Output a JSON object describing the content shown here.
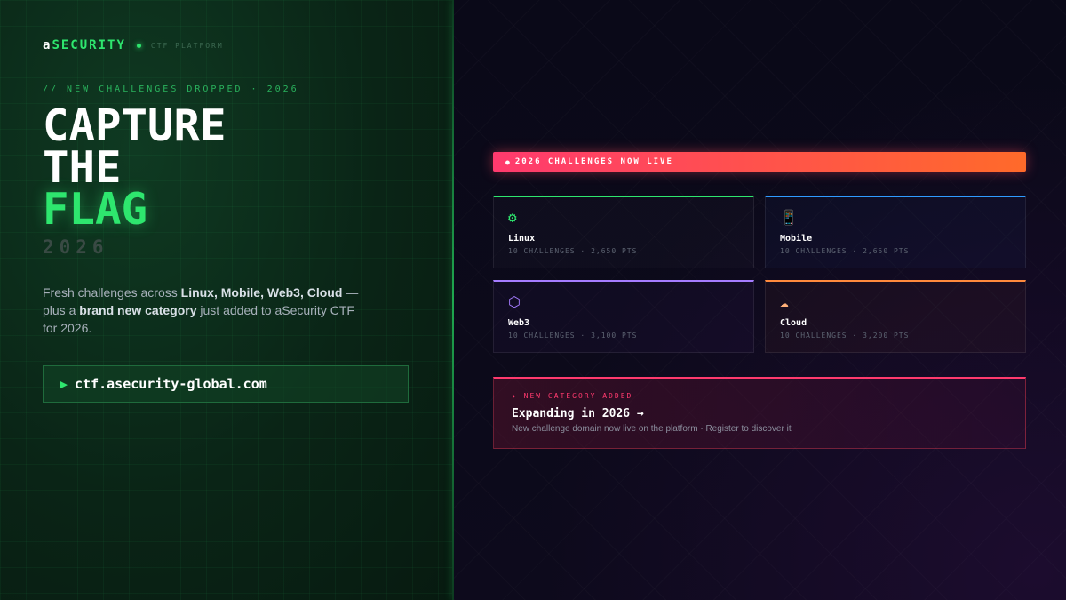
{
  "brand": {
    "prefix": "a",
    "name": "SECURITY",
    "sub": "CTF PLATFORM"
  },
  "hero": {
    "tagline": "// NEW CHALLENGES DROPPED · 2026",
    "line1": "CAPTURE",
    "line2": "THE",
    "line3": "FLAG",
    "year": "2026"
  },
  "description": {
    "t1": "Fresh challenges across ",
    "categories": "Linux, Mobile, Web3, Cloud",
    "t2": " — plus a ",
    "highlight": "brand new category",
    "t3": " just added to aSecurity CTF for 2026."
  },
  "url": {
    "icon": "play-icon",
    "text": "ctf.asecurity-global.com"
  },
  "banner": {
    "text": "2026 CHALLENGES NOW LIVE"
  },
  "cards": [
    {
      "title": "Linux",
      "meta": "10 CHALLENGES · 2,650 PTS",
      "icon": "gear-icon",
      "glyph": "⚙",
      "accent": "#2ee66e"
    },
    {
      "title": "Mobile",
      "meta": "10 CHALLENGES · 2,650 PTS",
      "icon": "phone-icon",
      "glyph": "📱",
      "accent": "#2f9bff"
    },
    {
      "title": "Web3",
      "meta": "10 CHALLENGES · 3,100 PTS",
      "icon": "hexagon-icon",
      "glyph": "⬡",
      "accent": "#a57cff"
    },
    {
      "title": "Cloud",
      "meta": "10 CHALLENGES · 3,200 PTS",
      "icon": "cloud-icon",
      "glyph": "☁",
      "accent": "#ff8a3d"
    }
  ],
  "new_category": {
    "label": "NEW CATEGORY ADDED",
    "title": "Expanding in 2026 →",
    "subtitle": "New challenge domain now live on the platform · Register to discover it"
  },
  "colors": {
    "accent_green": "#2ee66e",
    "banner_start": "#ff3a6e",
    "banner_end": "#ff6a2a"
  }
}
